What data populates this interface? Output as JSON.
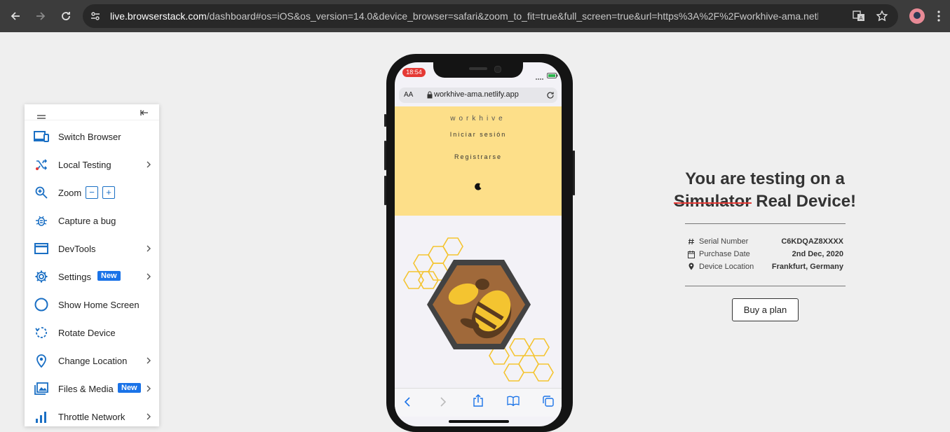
{
  "browser": {
    "url_host": "live.browserstack.com",
    "url_path": "/dashboard#os=iOS&os_version=14.0&device_browser=safari&zoom_to_fit=true&full_screen=true&url=https%3A%2F%2Fworkhive-ama.netli…",
    "icons": [
      "back-icon",
      "forward-icon",
      "reload-icon",
      "site-info-icon",
      "translate-icon",
      "bookmark-star-icon",
      "profile-avatar",
      "more-menu-icon"
    ]
  },
  "sidebar": {
    "items": [
      {
        "label": "Switch Browser",
        "icon": "devices-icon",
        "chevron": false
      },
      {
        "label": "Local Testing",
        "icon": "local-testing-icon",
        "chevron": true
      },
      {
        "label": "Zoom",
        "icon": "zoom-icon",
        "chevron": false,
        "zoom_out": "−",
        "zoom_in": "+"
      },
      {
        "label": "Capture a bug",
        "icon": "bug-icon",
        "chevron": false
      },
      {
        "label": "DevTools",
        "icon": "devtools-icon",
        "chevron": true
      },
      {
        "label": "Settings",
        "icon": "gear-icon",
        "chevron": true,
        "badge": "New"
      },
      {
        "label": "Show Home Screen",
        "icon": "home-circle-icon",
        "chevron": false
      },
      {
        "label": "Rotate Device",
        "icon": "rotate-icon",
        "chevron": false
      },
      {
        "label": "Change Location",
        "icon": "location-pin-icon",
        "chevron": true
      },
      {
        "label": "Files & Media",
        "icon": "image-icon",
        "chevron": true,
        "badge": "New"
      },
      {
        "label": "Throttle Network",
        "icon": "signal-icon",
        "chevron": true
      }
    ]
  },
  "device": {
    "status_time": "18:54",
    "addr_aa": "AA",
    "addr_url": "workhive-ama.netlify.app",
    "site_brand": "workhive",
    "site_login": "Iniciar sesión",
    "site_register": "Registrarse"
  },
  "panel": {
    "title_line1": "You are testing on a",
    "title_strike": "Simulator",
    "title_line2_rest": " Real Device!",
    "rows": [
      {
        "label": "Serial Number",
        "value": "C6KDQAZ8XXXX",
        "icon": "hash-icon"
      },
      {
        "label": "Purchase Date",
        "value": "2nd Dec, 2020",
        "icon": "calendar-icon"
      },
      {
        "label": "Device Location",
        "value": "Frankfurt, Germany",
        "icon": "location-pin-icon"
      }
    ],
    "buy_label": "Buy a plan"
  },
  "colors": {
    "accent_blue": "#1a73e8",
    "site_yellow": "#fddf89",
    "strike_red": "#e53935",
    "chrome_dark": "#3c3c3c"
  }
}
